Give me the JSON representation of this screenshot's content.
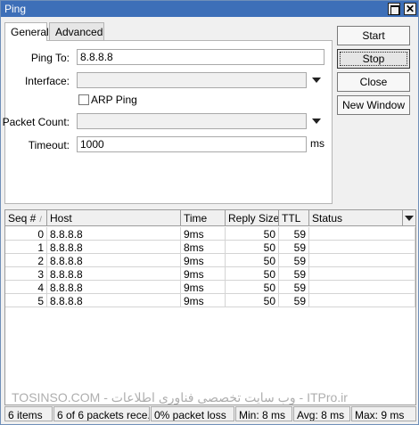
{
  "window": {
    "title": "Ping"
  },
  "tabs": [
    {
      "label": "General"
    },
    {
      "label": "Advanced"
    }
  ],
  "form": {
    "ping_to": {
      "label": "Ping To:",
      "value": "8.8.8.8"
    },
    "interface": {
      "label": "Interface:",
      "value": ""
    },
    "arp_ping": {
      "label": "ARP Ping",
      "checked": false
    },
    "packet_count": {
      "label": "Packet Count:",
      "value": ""
    },
    "timeout": {
      "label": "Timeout:",
      "value": "1000",
      "unit": "ms"
    }
  },
  "buttons": {
    "start": "Start",
    "stop": "Stop",
    "close": "Close",
    "new_window": "New Window"
  },
  "table": {
    "columns": [
      "Seq #",
      "Host",
      "Time",
      "Reply Size",
      "TTL",
      "Status"
    ],
    "sort_indicator": "/",
    "rows": [
      {
        "seq": "0",
        "host": "8.8.8.8",
        "time": "9ms",
        "size": "50",
        "ttl": "59",
        "status": ""
      },
      {
        "seq": "1",
        "host": "8.8.8.8",
        "time": "8ms",
        "size": "50",
        "ttl": "59",
        "status": ""
      },
      {
        "seq": "2",
        "host": "8.8.8.8",
        "time": "9ms",
        "size": "50",
        "ttl": "59",
        "status": ""
      },
      {
        "seq": "3",
        "host": "8.8.8.8",
        "time": "9ms",
        "size": "50",
        "ttl": "59",
        "status": ""
      },
      {
        "seq": "4",
        "host": "8.8.8.8",
        "time": "9ms",
        "size": "50",
        "ttl": "59",
        "status": ""
      },
      {
        "seq": "5",
        "host": "8.8.8.8",
        "time": "9ms",
        "size": "50",
        "ttl": "59",
        "status": ""
      }
    ]
  },
  "statusbar": {
    "items": "6 items",
    "received": "6 of 6 packets rece...",
    "loss": "0% packet loss",
    "min": "Min: 8 ms",
    "avg": "Avg: 8 ms",
    "max": "Max: 9 ms"
  },
  "watermark": "TOSINSO.COM - وب سایت تخصصی فناوری اطلاعات - ITPro.ir",
  "colors": {
    "titlebar": "#3d6fb8",
    "window_bg": "#f0f0f0"
  }
}
